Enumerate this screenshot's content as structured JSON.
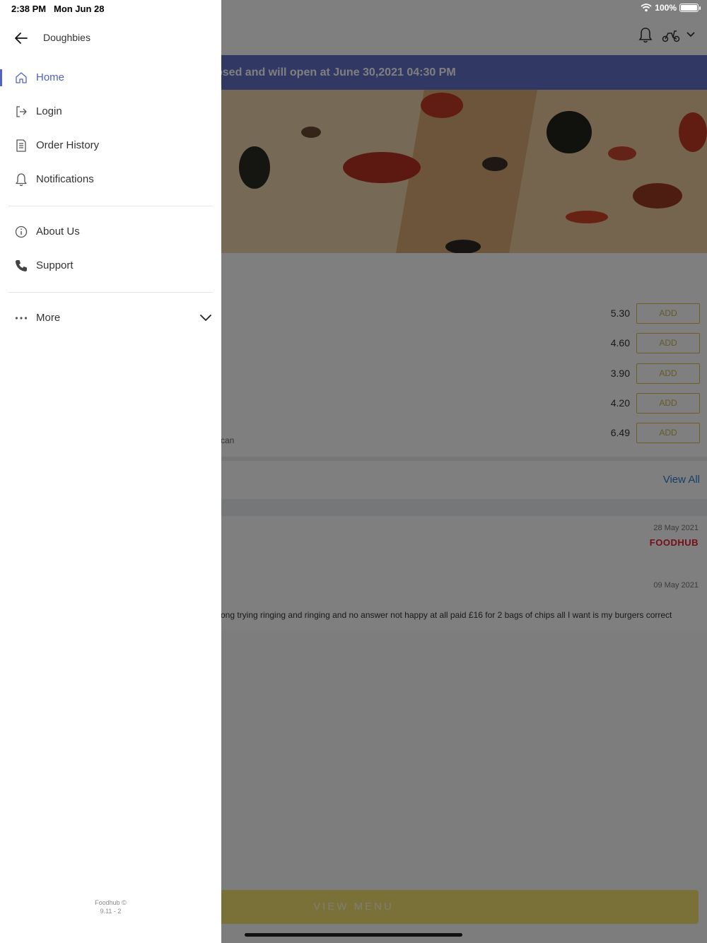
{
  "status_bar": {
    "time": "2:38 PM",
    "date": "Mon Jun 28",
    "battery": "100%"
  },
  "app": {
    "closed_banner": "osed and will open at June 30,2021 04:30 PM",
    "items": [
      {
        "price": "5.30",
        "add_label": "ADD"
      },
      {
        "price": "4.60",
        "add_label": "ADD"
      },
      {
        "price": "3.90",
        "add_label": "ADD"
      },
      {
        "price": "4.20",
        "add_label": "ADD"
      },
      {
        "price": "6.49",
        "add_label": "ADD"
      }
    ],
    "item_desc_fragment": "can",
    "view_all": "View All",
    "reviews": [
      {
        "date": "28 May 2021",
        "source": "FOODHUB"
      },
      {
        "date": "09 May 2021",
        "text": "ong trying ringing and ringing and no answer not happy at all paid £16 for 2 bags of chips all I want is my burgers correct"
      }
    ],
    "view_menu": "VIEW MENU"
  },
  "drawer": {
    "title": "Doughbies",
    "menu": [
      {
        "label": "Home",
        "icon": "home-icon",
        "active": true
      },
      {
        "label": "Login",
        "icon": "login-icon"
      },
      {
        "label": "Order History",
        "icon": "receipt-icon"
      },
      {
        "label": "Notifications",
        "icon": "bell-icon"
      }
    ],
    "secondary": [
      {
        "label": "About Us",
        "icon": "info-icon"
      },
      {
        "label": "Support",
        "icon": "phone-icon"
      }
    ],
    "more_label": "More",
    "footer": {
      "line1": "Foodhub ©",
      "line2": "9.11 - 2"
    }
  },
  "colors": {
    "accent": "#5163c6",
    "banner": "#6471c9",
    "view_menu": "#f4e270",
    "brand_red": "#e2232a"
  }
}
